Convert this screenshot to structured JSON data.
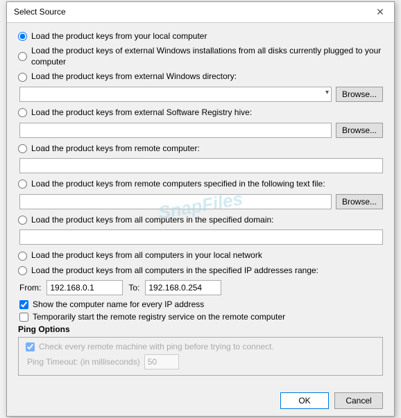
{
  "title": "Select Source",
  "close_label": "✕",
  "options": [
    {
      "id": "opt1",
      "label": "Load the product keys from your local computer",
      "checked": true,
      "has_input": false,
      "has_browse": false,
      "has_dropdown": false
    },
    {
      "id": "opt2",
      "label": "Load the product keys of external Windows installations from all disks currently plugged to your computer",
      "checked": false,
      "has_input": false,
      "has_browse": false,
      "has_dropdown": false
    },
    {
      "id": "opt3",
      "label": "Load the product keys from external Windows directory:",
      "checked": false,
      "has_input": false,
      "has_browse": true,
      "has_dropdown": true
    },
    {
      "id": "opt4",
      "label": "Load the product keys from external Software Registry hive:",
      "checked": false,
      "has_input": true,
      "has_browse": true,
      "has_dropdown": false
    },
    {
      "id": "opt5",
      "label": "Load the product keys from remote computer:",
      "checked": false,
      "has_input": true,
      "has_browse": false,
      "has_dropdown": false,
      "input_small": true
    },
    {
      "id": "opt6",
      "label": "Load the product keys from remote computers specified in the following text file:",
      "checked": false,
      "has_input": true,
      "has_browse": true,
      "has_dropdown": false
    },
    {
      "id": "opt7",
      "label": "Load the product keys from all computers in the specified domain:",
      "checked": false,
      "has_input": true,
      "has_browse": false,
      "has_dropdown": false,
      "input_small": true
    },
    {
      "id": "opt8",
      "label": "Load the product keys from all computers in your local network",
      "checked": false,
      "has_input": false,
      "has_browse": false,
      "has_dropdown": false
    },
    {
      "id": "opt9",
      "label": "Load the product keys from all computers in the specified IP addresses range:",
      "checked": false,
      "has_input": false,
      "has_browse": false,
      "has_dropdown": false,
      "has_ip": true
    }
  ],
  "ip": {
    "from_label": "From:",
    "from_value": "192.168.0.1",
    "to_label": "To:",
    "to_value": "192.168.0.254"
  },
  "checkbox1": {
    "label": "Show the computer name for every IP address",
    "checked": true,
    "disabled": false
  },
  "checkbox2": {
    "label": "Temporarily start the remote registry service on the remote computer",
    "checked": false,
    "disabled": false
  },
  "ping_section": {
    "title": "Ping Options",
    "check_label": "Check every remote machine with ping before trying to connect.",
    "check_checked": true,
    "timeout_label": "Ping Timeout: (in milliseconds)",
    "timeout_value": "50"
  },
  "browse_label": "Browse...",
  "ok_label": "OK",
  "cancel_label": "Cancel",
  "watermark": "SnapFiles"
}
